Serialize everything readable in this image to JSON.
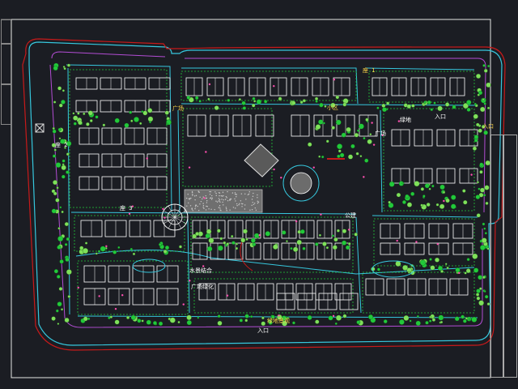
{
  "drawing": {
    "background": "#1b1d23",
    "frame_color": "#e6e6e6",
    "colors": {
      "perimeter_road": "#c81a1a",
      "inner_road": "#36c7dd",
      "boundary_wall": "#b34dd4",
      "buildings": "#ffffff",
      "greenery": "#22c93a",
      "trees": "#7fe05a",
      "flowers": "#ff4fb0",
      "plaza": "#b8b8b8",
      "labels": "#ffd84a",
      "labels_alt": "#ffffff"
    },
    "icons": [
      "north-arrow-icon",
      "plaza-circle-icon",
      "tree-symbol-icon"
    ]
  },
  "labels": [
    {
      "id": "lbl-1",
      "text": "座 1"
    },
    {
      "id": "lbl-2",
      "text": "广场"
    },
    {
      "id": "lbl-3",
      "text": "小区"
    },
    {
      "id": "lbl-4",
      "text": "绿地"
    },
    {
      "id": "lbl-5",
      "text": "入口"
    },
    {
      "id": "lbl-6",
      "text": "广场"
    },
    {
      "id": "lbl-7",
      "text": "座 2"
    },
    {
      "id": "lbl-8",
      "text": "入口"
    },
    {
      "id": "lbl-9",
      "text": "公建"
    },
    {
      "id": "lbl-10",
      "text": "座 3"
    },
    {
      "id": "lbl-11",
      "text": "绿地景观"
    },
    {
      "id": "lbl-12",
      "text": "水景结合"
    },
    {
      "id": "lbl-13",
      "text": "广场绿化"
    },
    {
      "id": "lbl-14",
      "text": "入口"
    }
  ]
}
